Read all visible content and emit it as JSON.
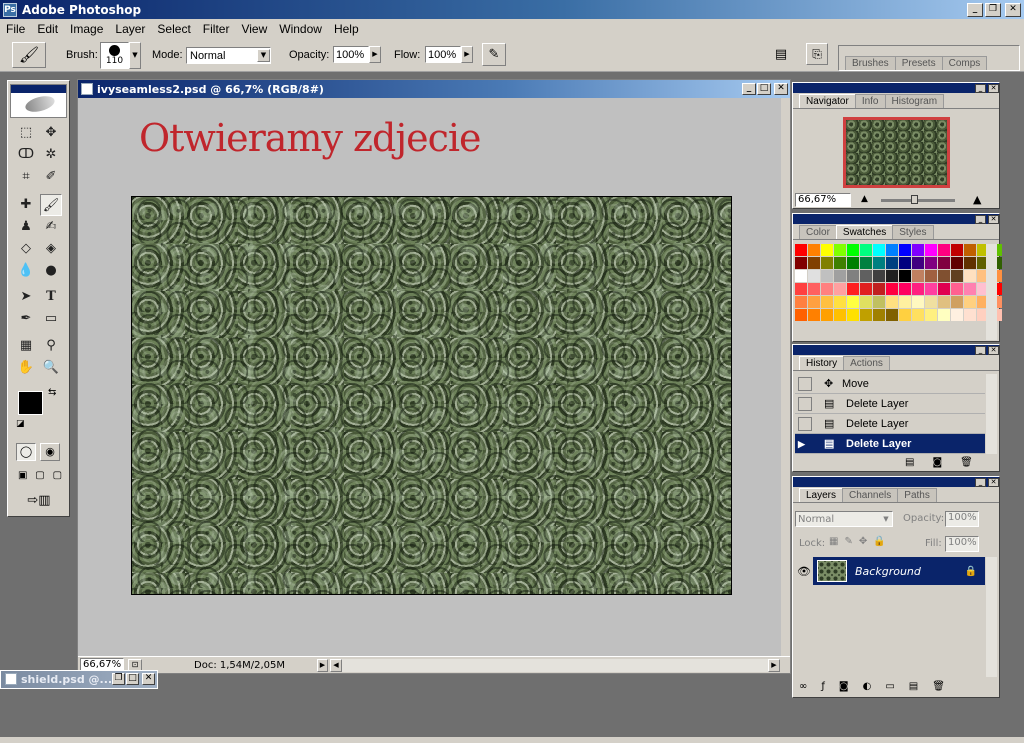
{
  "app": {
    "title": "Adobe Photoshop"
  },
  "menu": [
    "File",
    "Edit",
    "Image",
    "Layer",
    "Select",
    "Filter",
    "View",
    "Window",
    "Help"
  ],
  "options": {
    "brush_label": "Brush:",
    "brush_size": "110",
    "mode_label": "Mode:",
    "mode_value": "Normal",
    "opacity_label": "Opacity:",
    "opacity_value": "100%",
    "flow_label": "Flow:",
    "flow_value": "100%",
    "well_tabs": [
      "Brushes",
      "Presets",
      "Comps"
    ]
  },
  "document": {
    "title": "ivyseamless2.psd @ 66,7% (RGB/8#)",
    "overlay_text": "Otwieramy zdjecie",
    "zoom": "66,67%",
    "doc_info": "Doc: 1,54M/2,05M"
  },
  "navigator": {
    "tabs": [
      "Navigator",
      "Info",
      "Histogram"
    ],
    "zoom": "66,67%"
  },
  "color_panel": {
    "tabs": [
      "Color",
      "Swatches",
      "Styles"
    ]
  },
  "history": {
    "tabs": [
      "History",
      "Actions"
    ],
    "items": [
      "Move",
      "Delete Layer",
      "Delete Layer",
      "Delete Layer"
    ]
  },
  "layers": {
    "tabs": [
      "Layers",
      "Channels",
      "Paths"
    ],
    "blend_mode": "Normal",
    "opacity_label": "Opacity:",
    "opacity_value": "100%",
    "lock_label": "Lock:",
    "fill_label": "Fill:",
    "fill_value": "100%",
    "layer_name": "Background"
  },
  "minimized_doc": {
    "title": "shield.psd @..."
  },
  "colors": {
    "accent": "#0a246a",
    "overlay_text": "#c0262c",
    "chrome": "#d4d0c8"
  }
}
